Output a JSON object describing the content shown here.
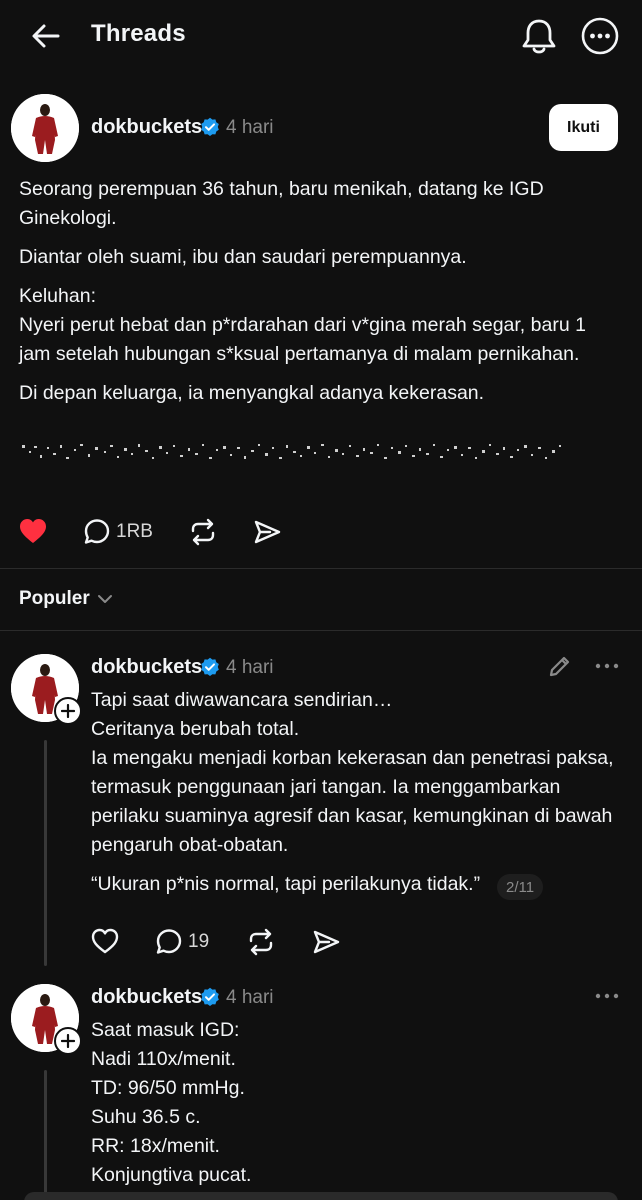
{
  "header": {
    "title": "Threads"
  },
  "post": {
    "username": "dokbuckets",
    "time": "4 hari",
    "follow_label": "Ikuti",
    "paragraphs": [
      "Seorang perempuan 36 tahun, baru menikah, datang ke IGD Ginekologi.",
      "Diantar oleh suami, ibu dan saudari perempuannya.",
      "Keluhan:\nNyeri perut hebat dan p*rdarahan dari v*gina merah segar, baru 1 jam setelah hubungan s*ksual pertamanya di malam pernikahan.",
      "Di depan keluarga, ia menyangkal adanya kekerasan."
    ],
    "liked": true,
    "reply_count": "1RB"
  },
  "sort": {
    "label": "Populer"
  },
  "replies": [
    {
      "username": "dokbuckets",
      "time": "4 hari",
      "paragraphs": [
        "Tapi saat diwawancara sendirian…\nCeritanya berubah total.\nIa mengaku menjadi korban kekerasan dan penetrasi paksa, termasuk penggunaan jari tangan. Ia menggambarkan perilaku suaminya agresif dan kasar, kemungkinan di bawah pengaruh obat-obatan.",
        "“Ukuran p*nis normal, tapi perilakunya tidak.”"
      ],
      "page_badge": "2/11",
      "reply_count": "19"
    },
    {
      "username": "dokbuckets",
      "time": "4 hari",
      "paragraphs": [
        "Saat masuk IGD:\nNadi 110x/menit.\nTD: 96/50 mmHg.\nSuhu 36.5 c.\nRR: 18x/menit.\nKonjungtiva pucat."
      ]
    }
  ],
  "colors": {
    "accent_like": "#ff3040",
    "verified": "#1d9bf0",
    "background": "#101010"
  }
}
